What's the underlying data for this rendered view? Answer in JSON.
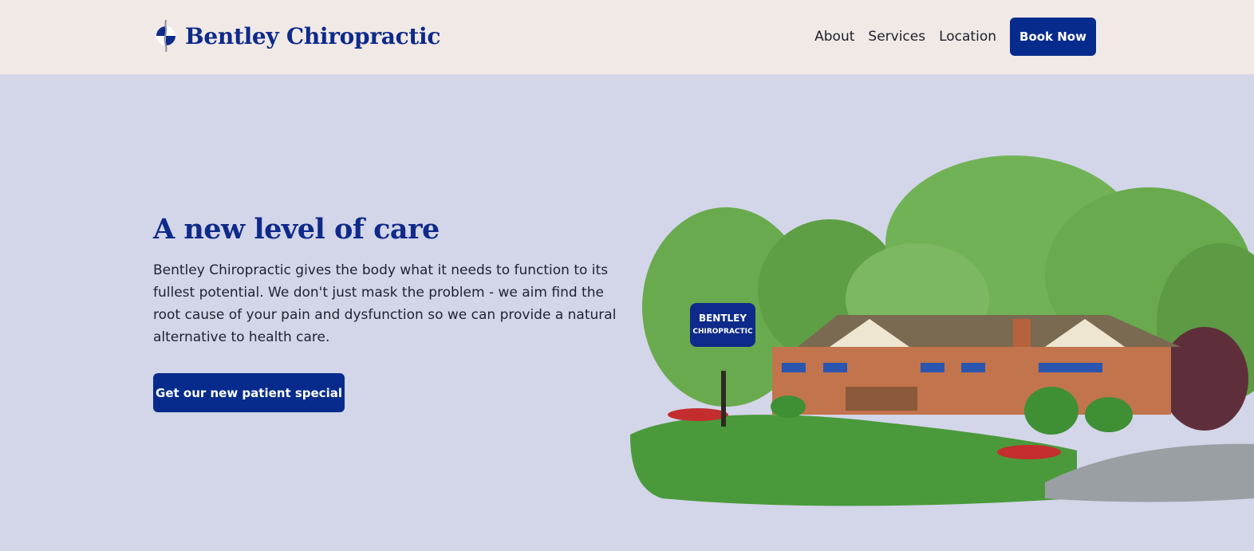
{
  "header": {
    "brand": "Bentley Chiropractic",
    "nav": [
      {
        "label": "About"
      },
      {
        "label": "Services"
      },
      {
        "label": "Location"
      }
    ],
    "cta_label": "Book Now"
  },
  "hero": {
    "title": "A new level of care",
    "body": "Bentley Chiropractic gives the body what it needs to function to its fullest potential. We don't just mask the problem - we aim find the root cause of your pain and dysfunction so we can provide a natural alternative to health care.",
    "cta_label": "Get our new patient special",
    "sign_text_line1": "BENTLEY",
    "sign_text_line2": "CHIROPRACTIC"
  },
  "colors": {
    "brand_blue": "#062b8c",
    "header_bg": "#f1e9e6",
    "hero_bg": "#d3d5e8"
  },
  "icons": {
    "logo": "spine-circle-logo-icon"
  }
}
